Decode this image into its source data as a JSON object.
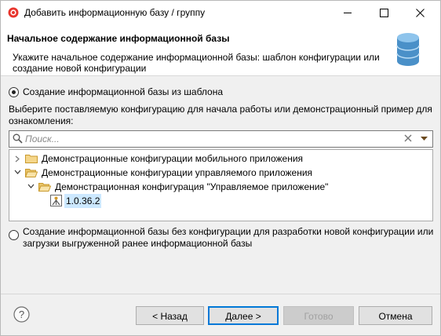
{
  "window": {
    "title": "Добавить информационную базу / группу"
  },
  "header": {
    "title": "Начальное содержание информационной базы",
    "description": "Укажите начальное содержание информационной базы: шаблон конфигурации или создание новой конфигурации"
  },
  "options": {
    "from_template": {
      "label": "Создание информационной базы из шаблона",
      "selected": true
    },
    "empty": {
      "label": "Создание информационной базы без конфигурации для разработки новой конфигурации или загрузки выгруженной ранее информационной базы",
      "selected": false
    }
  },
  "prompt": "Выберите поставляемую конфигурацию для начала работы или демонстрационный пример для ознакомления:",
  "search": {
    "placeholder": "Поиск...",
    "value": ""
  },
  "tree": {
    "items": [
      {
        "label": "Демонстрационные конфигурации мобильного приложения",
        "expanded": false,
        "icon": "folder-icon"
      },
      {
        "label": "Демонстрационные конфигурации управляемого приложения",
        "expanded": true,
        "icon": "folder-open-icon"
      },
      {
        "label": "Демонстрационная конфигурация \"Управляемое приложение\"",
        "expanded": true,
        "icon": "folder-open-icon"
      },
      {
        "label": "1.0.36.2",
        "selected": true,
        "icon": "template-icon"
      }
    ]
  },
  "buttons": {
    "back": "< Назад",
    "next": "Далее >",
    "finish": "Готово",
    "cancel": "Отмена"
  },
  "colors": {
    "selection": "#cce8ff",
    "accent": "#0078d7",
    "db_icon": "#4a90c8"
  }
}
